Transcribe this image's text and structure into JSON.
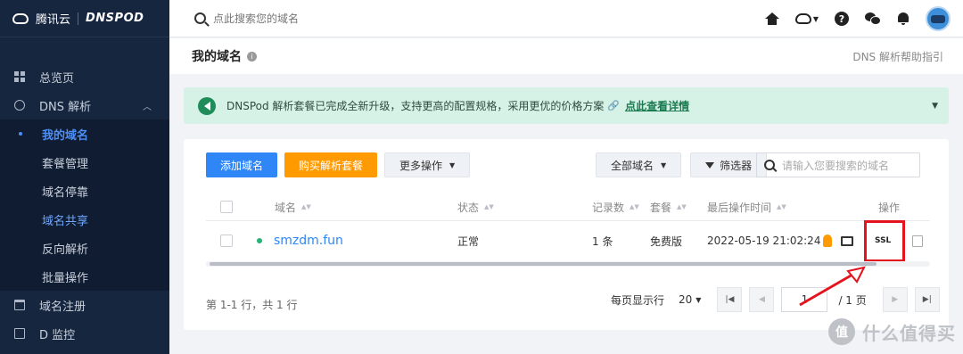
{
  "brand": {
    "cloud_name": "腾讯云",
    "product": "DNSPOD"
  },
  "topbar": {
    "search_placeholder": "点此搜索您的域名"
  },
  "sidebar": {
    "items": [
      {
        "label": "总览页",
        "icon": "grid-icon"
      },
      {
        "label": "DNS 解析",
        "icon": "globe-icon",
        "expanded": true
      },
      {
        "label": "域名注册",
        "icon": "calendar-icon"
      },
      {
        "label": "D 监控",
        "icon": "monitor-icon"
      }
    ],
    "sub_items": [
      {
        "label": "我的域名",
        "active": true
      },
      {
        "label": "套餐管理"
      },
      {
        "label": "域名停靠"
      },
      {
        "label": "域名共享"
      },
      {
        "label": "反向解析"
      },
      {
        "label": "批量操作"
      }
    ]
  },
  "page": {
    "title": "我的域名",
    "help_link": "DNS 解析帮助指引"
  },
  "notice": {
    "text": "DNSPod 解析套餐已完成全新升级，支持更高的配置规格，采用更优的价格方案",
    "link": "点此查看详情"
  },
  "toolbar": {
    "add_domain": "添加域名",
    "buy_plan": "购买解析套餐",
    "more_ops": "更多操作",
    "all_domains": "全部域名",
    "filter": "筛选器",
    "search_placeholder": "请输入您要搜索的域名"
  },
  "table": {
    "headers": {
      "domain": "域名",
      "status": "状态",
      "records": "记录数",
      "plan": "套餐",
      "last_op": "最后操作时间",
      "actions": "操作"
    },
    "rows": [
      {
        "domain": "smzdm.fun",
        "status": "正常",
        "records": "1 条",
        "plan": "免费版",
        "last_op": "2022-05-19 21:02:24",
        "ssl_label": "SSL"
      }
    ]
  },
  "pagination": {
    "summary": "第 1-1 行，共 1 行",
    "page_size_label": "每页显示行",
    "page_size": "20",
    "current_page": "1",
    "total_pages": "/ 1 页"
  },
  "watermark": {
    "icon_text": "值",
    "text": "什么值得买"
  },
  "colors": {
    "accent": "#2f86f6",
    "orange": "#ff9a00",
    "highlight_red": "#e3141d",
    "sidebar_bg": "#16263f",
    "notice_bg": "#d6f2e7"
  }
}
